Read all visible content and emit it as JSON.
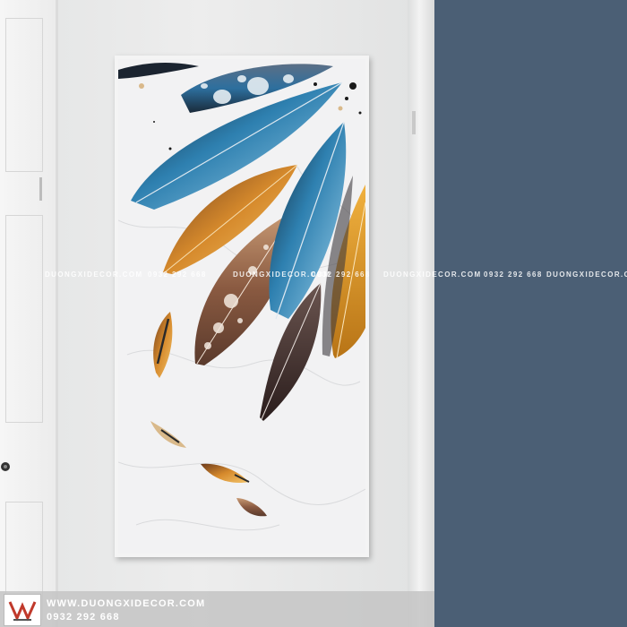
{
  "watermark": {
    "website": "DUONGXIDECOR.COM",
    "phone": "0932 292 668"
  },
  "footer": {
    "website": "WWW.DUONGXIDECOR.COM",
    "phone": "0932 292 668",
    "logo_icon": "duongxi-logo-icon"
  },
  "colors": {
    "accent_wall": "#4b5f75",
    "wall": "#e9eaea",
    "feather_blue": "#2d7fae",
    "feather_orange": "#c9822a",
    "feather_brown": "#6b3f2e"
  }
}
